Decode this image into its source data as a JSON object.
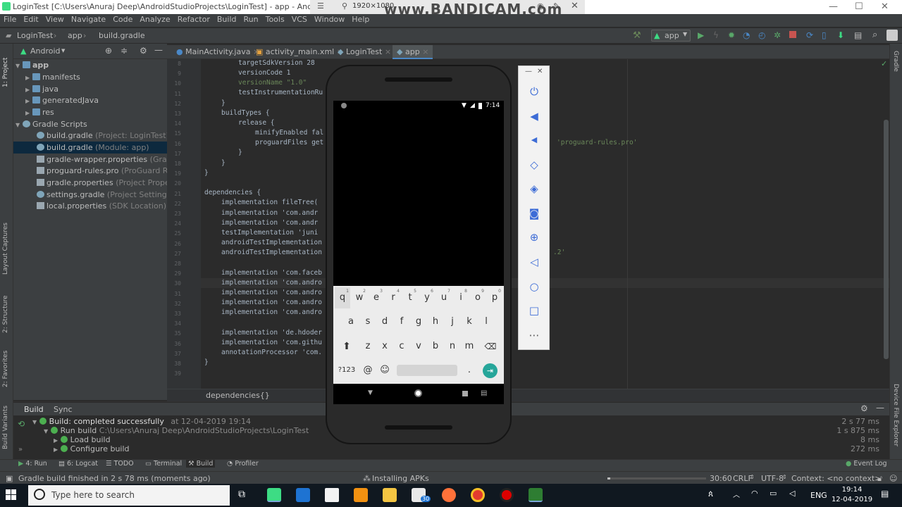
{
  "title": {
    "text": "LoginTest [C:\\Users\\Anuraj Deep\\AndroidStudioProjects\\LoginTest] - app - Android Studio",
    "resolution": "1920×1080",
    "watermark": "www.BANDICAM.com"
  },
  "menu": [
    "File",
    "Edit",
    "View",
    "Navigate",
    "Code",
    "Analyze",
    "Refactor",
    "Build",
    "Run",
    "Tools",
    "VCS",
    "Window",
    "Help"
  ],
  "breadcrumb": [
    "LoginTest",
    "app",
    "build.gradle"
  ],
  "toolbar": {
    "run_config": "app"
  },
  "project_panel": {
    "view": "Android",
    "items": [
      {
        "label": "app",
        "hint": ""
      },
      {
        "label": "manifests",
        "hint": ""
      },
      {
        "label": "java",
        "hint": ""
      },
      {
        "label": "generatedJava",
        "hint": ""
      },
      {
        "label": "res",
        "hint": ""
      },
      {
        "label": "Gradle Scripts",
        "hint": ""
      },
      {
        "label": "build.gradle",
        "hint": "(Project: LoginTest)"
      },
      {
        "label": "build.gradle",
        "hint": "(Module: app)"
      },
      {
        "label": "gradle-wrapper.properties",
        "hint": "(Gradle Ver"
      },
      {
        "label": "proguard-rules.pro",
        "hint": "(ProGuard Rules fo"
      },
      {
        "label": "gradle.properties",
        "hint": "(Project Properties)"
      },
      {
        "label": "settings.gradle",
        "hint": "(Project Settings)"
      },
      {
        "label": "local.properties",
        "hint": "(SDK Location)"
      }
    ]
  },
  "left_strip": [
    "1: Project",
    "Layout Captures",
    "2: Structure",
    "2: Favorites",
    "Build Variants"
  ],
  "right_strip": [
    "Gradle",
    "Device File Explorer"
  ],
  "editor_tabs": [
    "MainActivity.java",
    "activity_main.xml",
    "LoginTest",
    "app"
  ],
  "line_numbers": [
    "8",
    "9",
    "10",
    "11",
    "12",
    "13",
    "14",
    "15",
    "16",
    "17",
    "18",
    "19",
    "20",
    "21",
    "22",
    "23",
    "24",
    "25",
    "26",
    "27",
    "28",
    "29",
    "30",
    "31",
    "32",
    "33",
    "34",
    "35",
    "36",
    "37",
    "38",
    "39"
  ],
  "code": {
    "l8": "targetSdkVersion 28",
    "l9": "versionCode 1",
    "l10": "versionName \"1.0\"",
    "l11": "testInstrumentationRu",
    "l12": "}",
    "l13": "buildTypes {",
    "l14": "release {",
    "l15": "minifyEnabled fal",
    "l16": "proguardFiles get",
    "l16b": "'proguard-rules.pro'",
    "l17": "}",
    "l18": "}",
    "l19": "}",
    "l21": "dependencies {",
    "l22": "implementation fileTree(",
    "l23": "implementation 'com.andr",
    "l24": "implementation 'com.andr",
    "l25": "testImplementation 'juni",
    "l26": "androidTestImplementation",
    "l27": "androidTestImplementation",
    "l27b": ".2'",
    "l29": "implementation 'com.faceb",
    "l30": "implementation 'com.andro",
    "l31": "implementation 'com.andro",
    "l32": "implementation 'com.andro",
    "l33": "implementation 'com.andro",
    "l35": "implementation 'de.hdoder",
    "l36": "implementation 'com.githu",
    "l37": "annotationProcessor 'com.",
    "l38": "}"
  },
  "editor_footer": "dependencies{}",
  "build_panel": {
    "tabs": [
      "Build",
      "Sync"
    ],
    "rows": [
      {
        "label": "Build:",
        "text": "completed successfully",
        "meta": "at 12-04-2019 19:14",
        "time": "2 s 77 ms"
      },
      {
        "label": "Run build",
        "text": "C:\\Users\\Anuraj Deep\\AndroidStudioProjects\\LoginTest",
        "meta": "",
        "time": "1 s 875 ms"
      },
      {
        "label": "Load build",
        "text": "",
        "meta": "",
        "time": "8 ms"
      },
      {
        "label": "Configure build",
        "text": "",
        "meta": "",
        "time": "272 ms"
      }
    ]
  },
  "bottom_tabs": [
    "4: Run",
    "6: Logcat",
    "TODO",
    "Terminal",
    "Build",
    "Profiler"
  ],
  "event_log": "Event Log",
  "status": {
    "message": "Gradle build finished in 2 s 78 ms (moments ago)",
    "task": "Installing APKs",
    "position": "30:60",
    "line_sep": "CRLF",
    "encoding": "UTF-8",
    "context": "Context: <no context>"
  },
  "emulator": {
    "time": "7:14",
    "keyboard": {
      "row1": [
        "q",
        "w",
        "e",
        "r",
        "t",
        "y",
        "u",
        "i",
        "o",
        "p"
      ],
      "row1_sup": [
        "1",
        "2",
        "3",
        "4",
        "5",
        "6",
        "7",
        "8",
        "9",
        "0"
      ],
      "row2": [
        "a",
        "s",
        "d",
        "f",
        "g",
        "h",
        "j",
        "k",
        "l"
      ],
      "row3": [
        "z",
        "x",
        "c",
        "v",
        "b",
        "n",
        "m"
      ],
      "sym": "?123",
      "at": "@",
      "dot": "."
    }
  },
  "taskbar": {
    "search_placeholder": "Type here to search",
    "lang": "ENG",
    "time": "19:14",
    "date": "12-04-2019",
    "mail_badge": "30"
  }
}
